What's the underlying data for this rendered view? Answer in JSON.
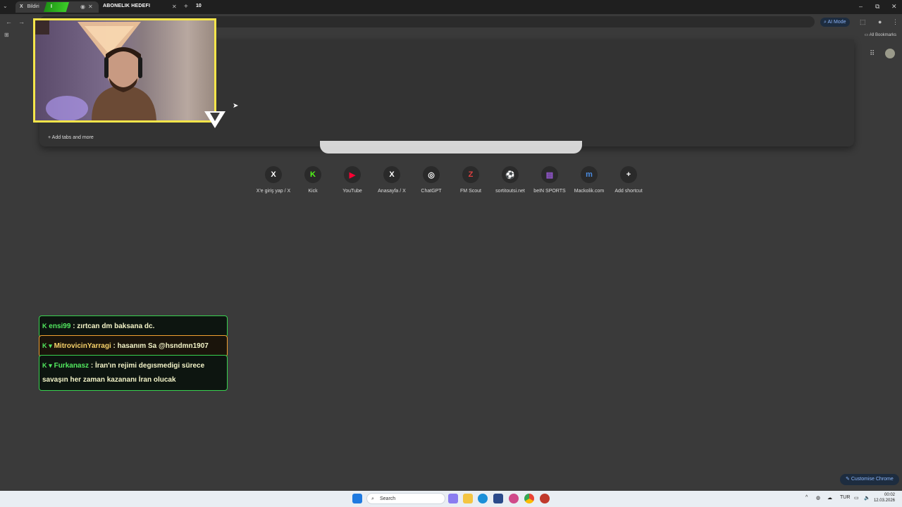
{
  "tabs": {
    "active_tab_label": "Bildiri",
    "second_tab_label": "I",
    "subscriber_goal_label": "ABONELIK HEDEFI",
    "subscriber_goal_count": "10"
  },
  "toolbar": {
    "ai_mode_label": "AI Mode",
    "all_bookmarks_label": "All Bookmarks"
  },
  "dropdown": {
    "add_tabs_label": "Add tabs and more"
  },
  "shortcuts": [
    {
      "label": "X'e giriş yap / X",
      "glyph": "X",
      "color": "#ffffff"
    },
    {
      "label": "Kick",
      "glyph": "K",
      "color": "#53fc18"
    },
    {
      "label": "YouTube",
      "glyph": "▶",
      "color": "#ff0033"
    },
    {
      "label": "Anasayfa / X",
      "glyph": "X",
      "color": "#ffffff"
    },
    {
      "label": "ChatGPT",
      "glyph": "◎",
      "color": "#ffffff"
    },
    {
      "label": "FM Scout",
      "glyph": "Z",
      "color": "#e04040"
    },
    {
      "label": "sortitoutsi.net",
      "glyph": "⚽",
      "color": "#6aa0ff"
    },
    {
      "label": "beIN SPORTS",
      "glyph": "▤",
      "color": "#9a5ad8"
    },
    {
      "label": "Mackolik.com",
      "glyph": "m",
      "color": "#4a8be0"
    },
    {
      "label": "Add shortcut",
      "glyph": "+",
      "color": "#ffffff"
    }
  ],
  "chat": [
    {
      "user": "ensi99",
      "message": ": zırtcan dm baksana dc."
    },
    {
      "user": "MitrovicinYarragi",
      "message": ": hasanım Sa @hsndmn1907"
    },
    {
      "user": "Furkanasz",
      "message": ": İran'ın rejimi degısmedigi sürece savaşın her zaman kazananı İran olucak"
    }
  ],
  "customise_label": "Customise Chrome",
  "taskbar": {
    "search_placeholder": "Search",
    "language": "TUR",
    "time": "00:02",
    "date": "12.03.2026"
  }
}
